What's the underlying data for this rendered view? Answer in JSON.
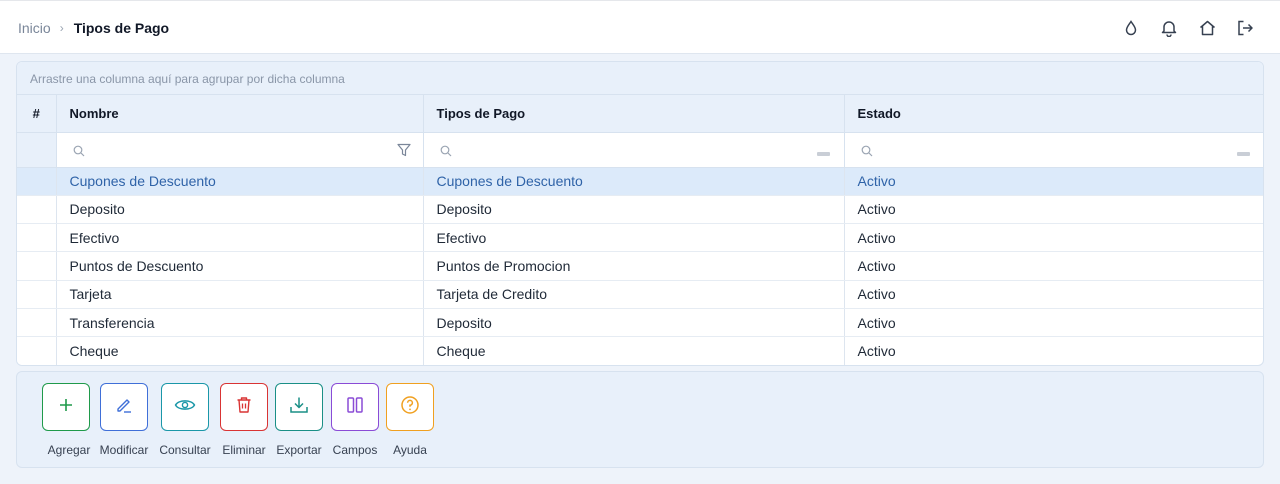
{
  "breadcrumb": {
    "home": "Inicio",
    "separator": "›",
    "current": "Tipos de Pago"
  },
  "header_icons": [
    "drop-icon",
    "bell-icon",
    "home-icon",
    "logout-icon"
  ],
  "grid": {
    "group_hint": "Arrastre una columna aquí para agrupar por dicha columna",
    "columns": {
      "num": "#",
      "nombre": "Nombre",
      "tipos": "Tipos de Pago",
      "estado": "Estado"
    },
    "rows": [
      {
        "nombre": "Cupones de Descuento",
        "tipos": "Cupones de Descuento",
        "estado": "Activo",
        "selected": true
      },
      {
        "nombre": "Deposito",
        "tipos": "Deposito",
        "estado": "Activo"
      },
      {
        "nombre": "Efectivo",
        "tipos": "Efectivo",
        "estado": "Activo"
      },
      {
        "nombre": "Puntos de Descuento",
        "tipos": "Puntos de Promocion",
        "estado": "Activo"
      },
      {
        "nombre": "Tarjeta",
        "tipos": "Tarjeta de Credito",
        "estado": "Activo"
      },
      {
        "nombre": "Transferencia",
        "tipos": "Deposito",
        "estado": "Activo"
      },
      {
        "nombre": "Cheque",
        "tipos": "Cheque",
        "estado": "Activo"
      }
    ]
  },
  "toolbar": {
    "agregar": "Agregar",
    "modificar": "Modificar",
    "consultar": "Consultar",
    "eliminar": "Eliminar",
    "exportar": "Exportar",
    "campos": "Campos",
    "ayuda": "Ayuda"
  },
  "colors": {
    "agregar": "#1f9a4a",
    "modificar": "#3f6fd8",
    "consultar": "#1a97a8",
    "eliminar": "#d93434",
    "exportar": "#1a8f86",
    "campos": "#8a4bd6",
    "ayuda": "#f0a020",
    "selected_row": "#dceafa"
  }
}
